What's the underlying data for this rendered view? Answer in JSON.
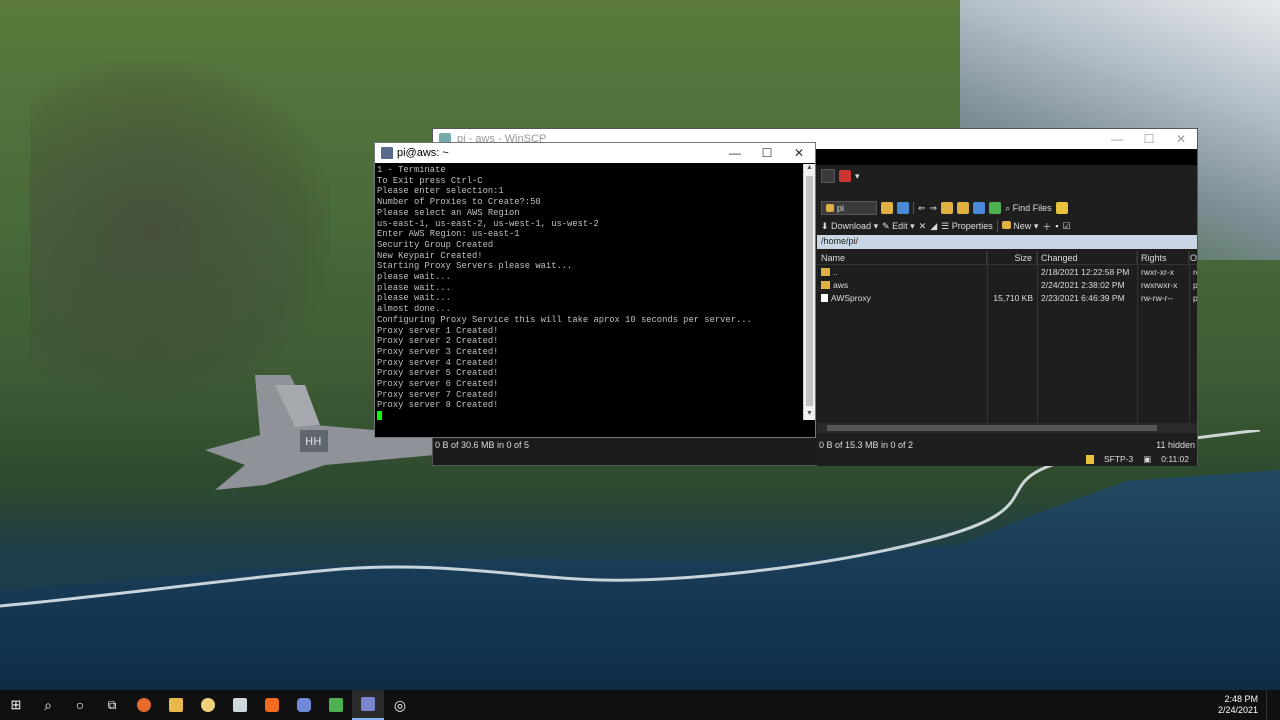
{
  "putty": {
    "title": "pi@aws: ~",
    "lines": [
      "1 - Terminate",
      "To Exit press Ctrl-C",
      "Please enter selection:1",
      "Number of Proxies to Create?:50",
      "Please select an AWS Region",
      "us-east-1, us-east-2, us-west-1, us-west-2",
      "Enter AWS Region: us-east-1",
      "Security Group Created",
      "New Keypair Created!",
      "Starting Proxy Servers please wait...",
      "please wait...",
      "please wait...",
      "please wait...",
      "almost done...",
      "Configuring Proxy Service this will take aprox 10 seconds per server...",
      "Proxy server 1 Created!",
      "Proxy server 2 Created!",
      "Proxy server 3 Created!",
      "Proxy server 4 Created!",
      "Proxy server 5 Created!",
      "Proxy server 6 Created!",
      "Proxy server 7 Created!",
      "Proxy server 8 Created!"
    ],
    "minimize": "—",
    "maximize": "☐",
    "close": "✕"
  },
  "winscp": {
    "title": "pi - aws - WinSCP",
    "minimize": "—",
    "maximize": "☐",
    "close": "✕",
    "toolbar": {
      "location": "pi",
      "find_files": "Find Files",
      "download": "Download",
      "edit": "Edit",
      "properties": "Properties",
      "new": "New"
    },
    "path": "/home/pi/",
    "columns": {
      "name": "Name",
      "size": "Size",
      "changed": "Changed",
      "rights": "Rights",
      "owner": "O"
    },
    "files": [
      {
        "name": "..",
        "size": "",
        "changed": "2/18/2021 12:22:58 PM",
        "rights": "rwxr-xr-x",
        "owner": "ro",
        "type": "parent"
      },
      {
        "name": "aws",
        "size": "",
        "changed": "2/24/2021 2:38:02 PM",
        "rights": "rwxrwxr-x",
        "owner": "p",
        "type": "folder"
      },
      {
        "name": "AWSproxy",
        "size": "15,710 KB",
        "changed": "2/23/2021 6:46:39 PM",
        "rights": "rw-rw-r--",
        "owner": "p",
        "type": "file"
      }
    ],
    "left_status": "0 B of 30.6 MB in 0 of 5",
    "right_status": "0 B of 15.3 MB in 0 of 2",
    "hidden": "11 hidden",
    "protocol": "SFTP-3",
    "elapsed": "0:11:02"
  },
  "taskbar": {
    "time": "2:48 PM",
    "date": "2/24/2021"
  }
}
